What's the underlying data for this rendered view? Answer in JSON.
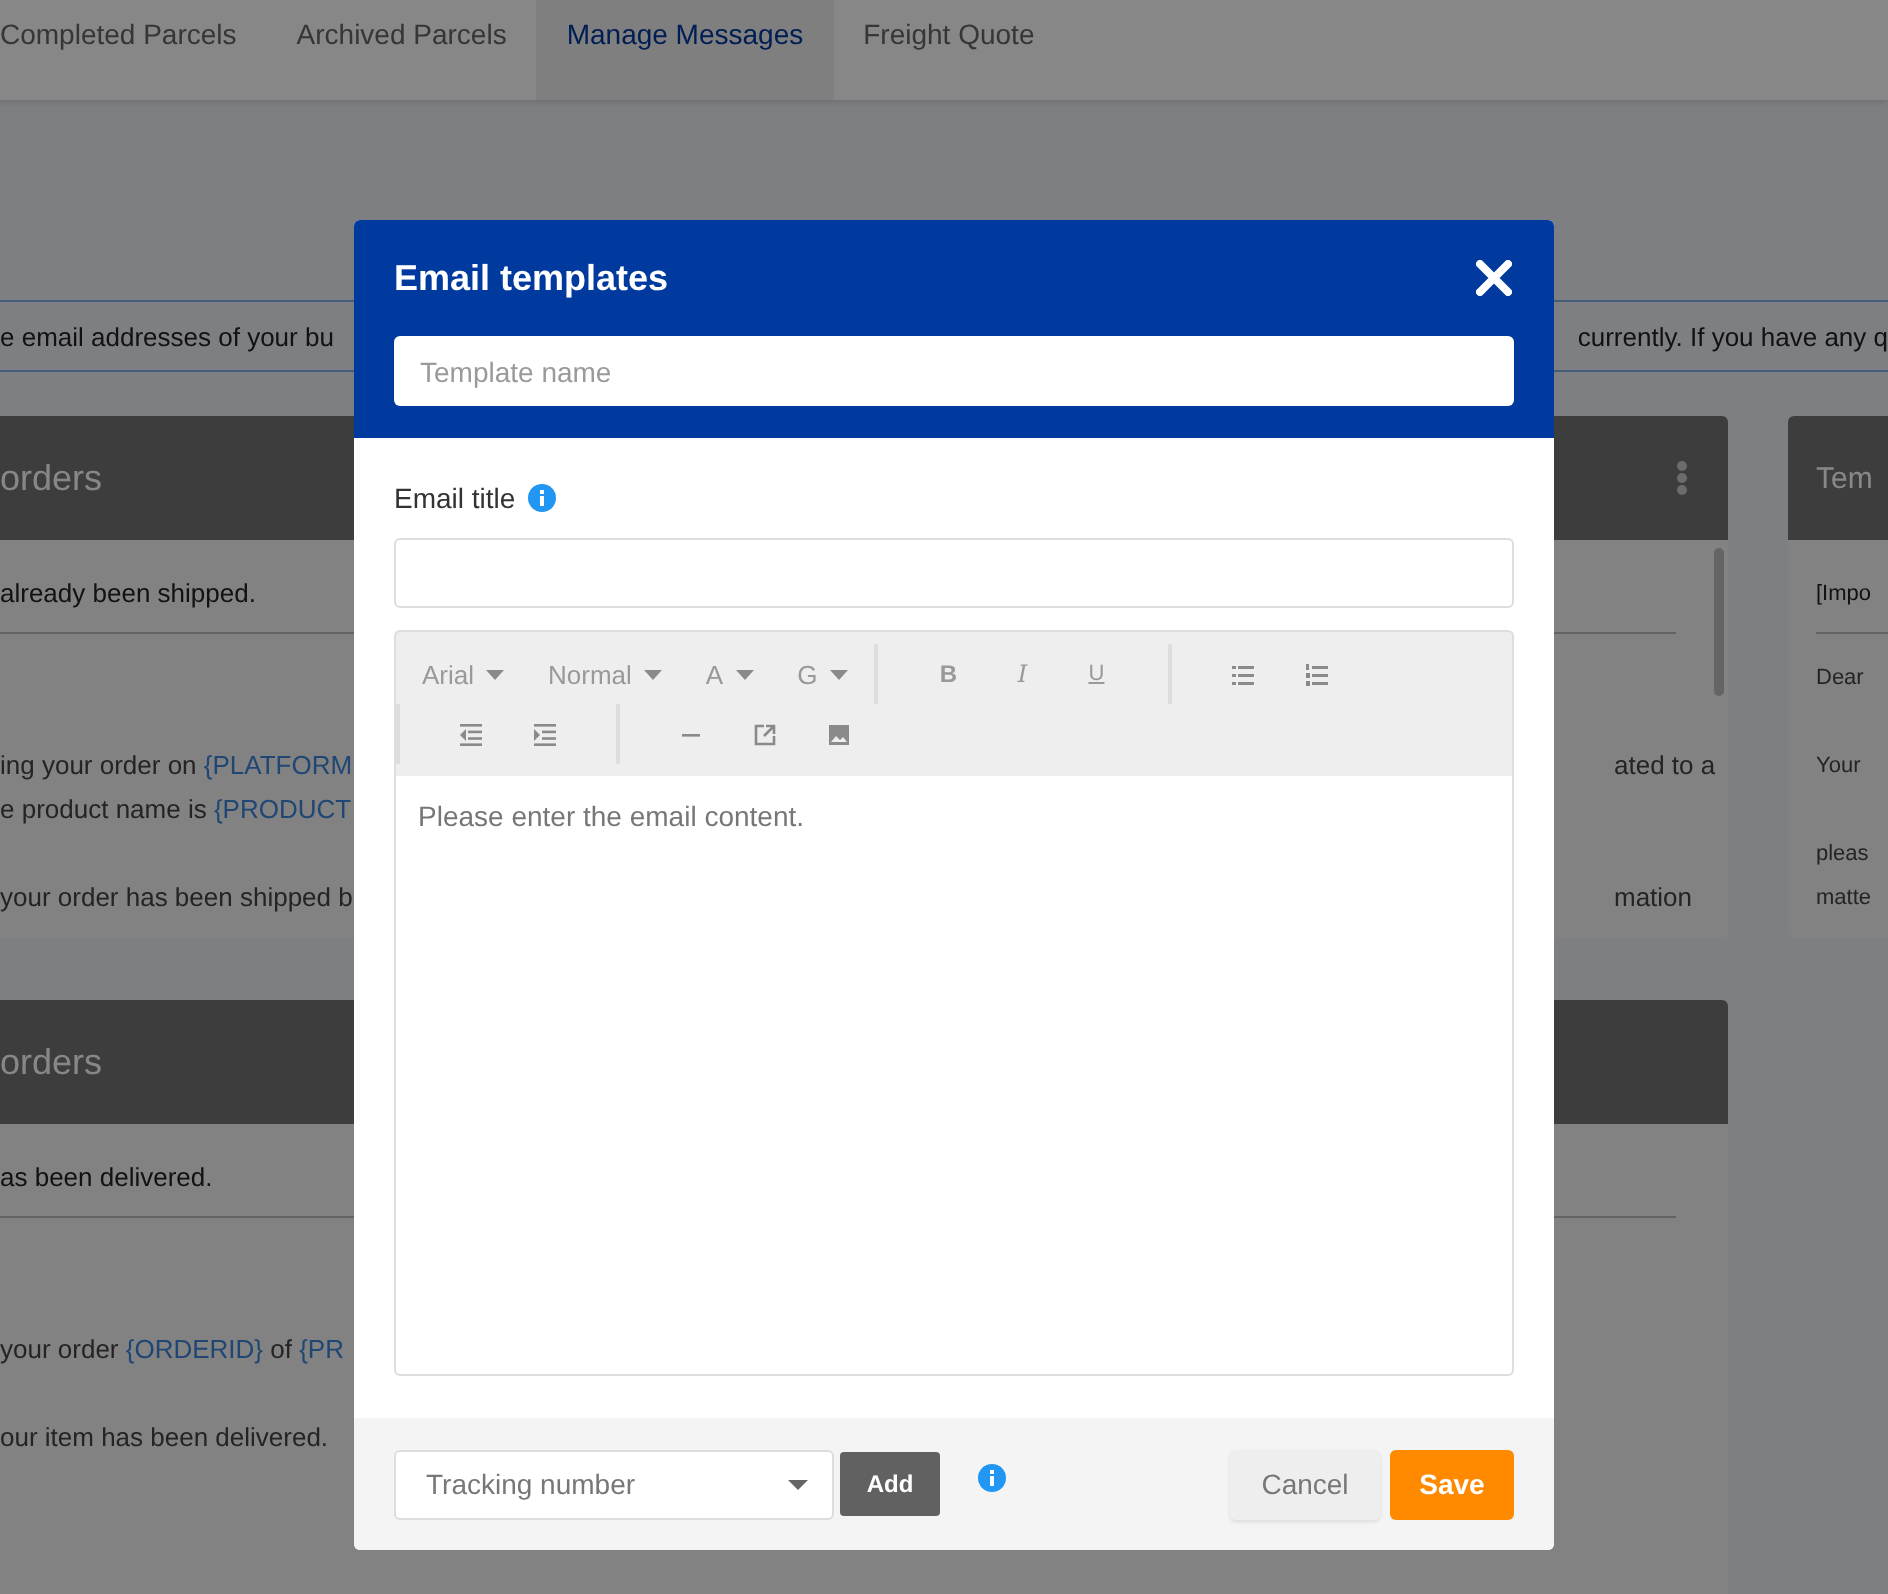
{
  "tabs": [
    {
      "label": "Completed Parcels",
      "selected": false
    },
    {
      "label": "Archived Parcels",
      "selected": false
    },
    {
      "label": "Manage Messages",
      "selected": true
    },
    {
      "label": "Freight Quote",
      "selected": false
    }
  ],
  "notice": {
    "text_left": "e email addresses of your bu",
    "text_right": "currently. If you have any q"
  },
  "cards": [
    {
      "title": "orders",
      "menu": true,
      "scrollbar": true,
      "subject": "already been shipped.",
      "paragraphs": [
        [
          {
            "left": [
              {
                "kind": "plain",
                "text": "ing your order on "
              },
              {
                "kind": "variable",
                "text": "{PLATFORM"
              }
            ],
            "right": "ated to a"
          },
          {
            "left": [
              {
                "kind": "plain",
                "text": "e product name is "
              },
              {
                "kind": "variable",
                "text": "{PRODUCT"
              }
            ]
          }
        ],
        [
          {
            "left": [
              {
                "kind": "plain",
                "text": "your order has been shipped b"
              }
            ],
            "right": "mation"
          }
        ]
      ]
    },
    {
      "title": "orders",
      "menu": false,
      "scrollbar": false,
      "subject": "as been delivered.",
      "paragraphs": [
        [
          {
            "left": [
              {
                "kind": "plain",
                "text": "your order "
              },
              {
                "kind": "variable",
                "text": "{ORDERID}"
              },
              {
                "kind": "plain",
                "text": " of "
              },
              {
                "kind": "variable",
                "text": "{PR"
              }
            ]
          }
        ],
        [
          {
            "left": [
              {
                "kind": "plain",
                "text": "our item has been delivered."
              }
            ]
          }
        ]
      ]
    },
    {
      "title": "Tem",
      "menu": false,
      "scrollbar": false,
      "subject": "[Impo",
      "paragraphs": [
        [
          {
            "left": [
              {
                "kind": "plain",
                "text": "Dear"
              }
            ]
          }
        ],
        [
          {
            "left": [
              {
                "kind": "plain",
                "text": "Your"
              }
            ]
          }
        ],
        [
          {
            "left": [
              {
                "kind": "plain",
                "text": "pleas"
              }
            ]
          },
          {
            "left": [
              {
                "kind": "plain",
                "text": "matte"
              }
            ]
          }
        ]
      ]
    }
  ],
  "dialog": {
    "title": "Email templates",
    "template_name": {
      "placeholder": "Template name"
    },
    "email_title": {
      "label": "Email title"
    },
    "toolbar": [
      [
        {
          "kind": "dropdown",
          "label": "Arial"
        },
        {
          "kind": "dropdown",
          "label": "Normal"
        },
        {
          "kind": "dropdown",
          "label": "A"
        },
        {
          "kind": "dropdown",
          "label": "G"
        }
      ],
      [
        {
          "kind": "bold",
          "label": "B"
        },
        {
          "kind": "italic",
          "label": "I"
        },
        {
          "kind": "underline",
          "label": "U"
        }
      ],
      [
        {
          "kind": "bullet-list"
        },
        {
          "kind": "numbered-list"
        }
      ],
      [
        {
          "kind": "outdent"
        },
        {
          "kind": "indent"
        }
      ],
      [
        {
          "kind": "rule"
        },
        {
          "kind": "link"
        },
        {
          "kind": "image"
        }
      ]
    ],
    "content": {
      "placeholder": "Please enter the email content."
    },
    "tracking_select": {
      "placeholder": "Tracking number"
    },
    "add_button": "Add",
    "cancel_button": "Cancel",
    "save_button": "Save"
  }
}
